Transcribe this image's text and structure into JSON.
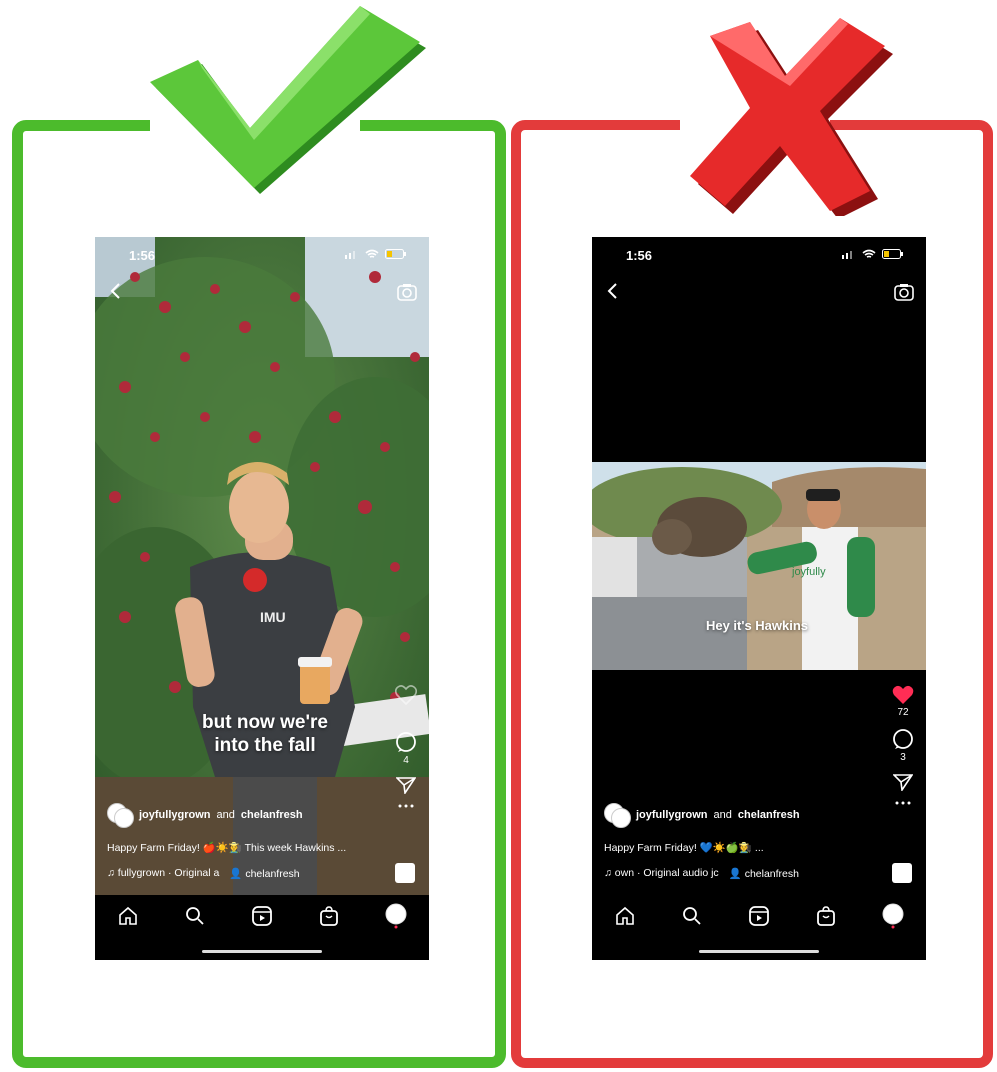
{
  "colors": {
    "good": "#4cbb2c",
    "bad": "#e33b3b",
    "like_active": "#ff2d55"
  },
  "good_example": {
    "status_time": "1:56",
    "overlay_caption_line1": "but now we're",
    "overlay_caption_line2": "into the fall",
    "comments_count": "4",
    "author_primary": "joyfullygrown",
    "author_joiner": "and",
    "author_secondary": "chelanfresh",
    "caption": "Happy Farm Friday! 🍎☀️🧑‍🌾 This week Hawkins ...",
    "audio_text": "fullygrown · Original a",
    "collab_user": "chelanfresh"
  },
  "bad_example": {
    "status_time": "1:56",
    "overlay_caption": "Hey it's Hawkins",
    "likes_count": "72",
    "comments_count": "3",
    "author_primary": "joyfullygrown",
    "author_joiner": "and",
    "author_secondary": "chelanfresh",
    "caption": "Happy Farm Friday! 💙☀️🍏🧑‍🌾 ...",
    "audio_text": "own · Original audio jc",
    "collab_user": "chelanfresh"
  },
  "icons": [
    "check-mark-icon",
    "x-mark-icon",
    "back-icon",
    "camera-icon",
    "heart-icon",
    "comment-icon",
    "share-icon",
    "more-icon",
    "music-icon",
    "person-icon",
    "home-icon",
    "search-icon",
    "reels-icon",
    "shop-icon",
    "profile-icon",
    "wifi-icon",
    "signal-icon",
    "battery-icon"
  ]
}
